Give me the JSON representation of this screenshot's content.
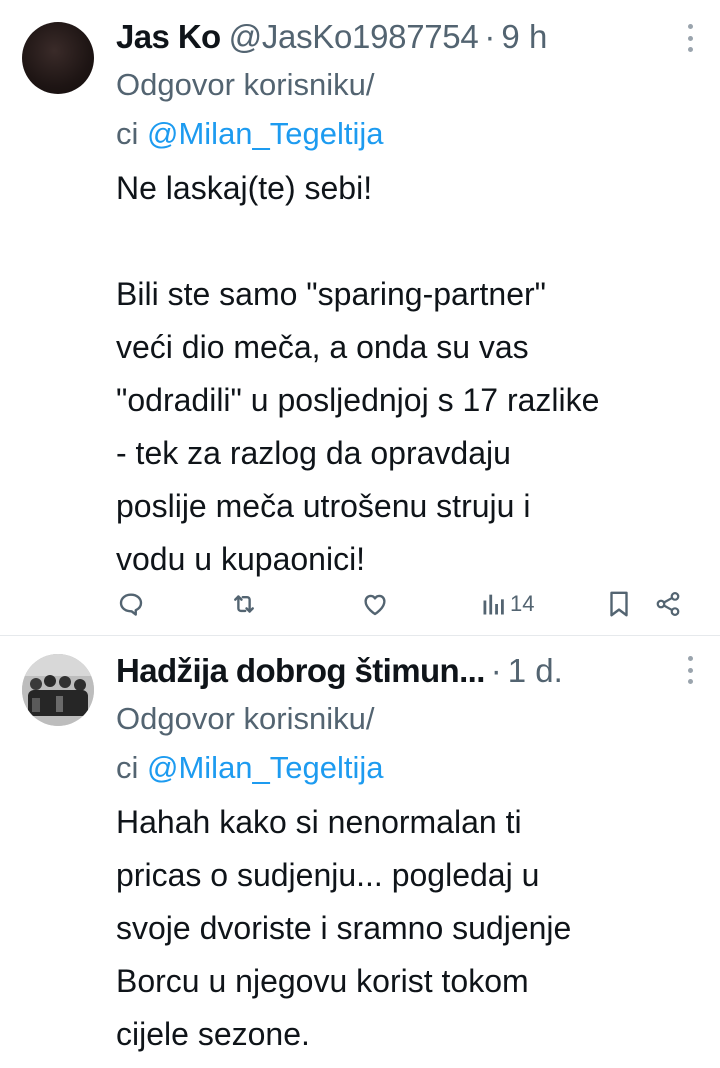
{
  "tweets": [
    {
      "name": "Jas Ko",
      "handle": "@JasKo1987754",
      "separator": "·",
      "time": "9 h",
      "reply_prefix_line1": "Odgovor korisniku/",
      "reply_prefix_line2": "ci ",
      "reply_to": "@Milan_Tegeltija",
      "body_lines": [
        "Ne laskaj(te) sebi!",
        "",
        "Bili ste samo \"sparing-partner\"",
        "veći dio meča, a onda su vas",
        "\"odradili\" u posljednjoj s 17 razlike",
        "- tek za razlog da opravdaju",
        "poslije meča utrošenu struju i",
        "vodu u kupaonici!"
      ],
      "views": "14",
      "icons": [
        "reply-icon",
        "retweet-icon",
        "like-icon",
        "views-icon",
        "bookmark-icon",
        "share-icon",
        "more-icon"
      ]
    },
    {
      "name": "Hadžija dobrog štimun...",
      "separator": "·",
      "time": "1 d.",
      "reply_prefix_line1": "Odgovor korisniku/",
      "reply_prefix_line2": "ci ",
      "reply_to": "@Milan_Tegeltija",
      "body_lines": [
        "Hahah kako si nenormalan ti",
        "pricas o sudjenju... pogledaj u",
        "svoje dvoriste i sramno sudjenje",
        "Borcu u njegovu korist tokom",
        "cijele sezone."
      ]
    }
  ],
  "colors": {
    "text": "#0f1419",
    "secondary": "#536471",
    "link": "#1d9bf0",
    "divider": "#e6e9ec"
  }
}
